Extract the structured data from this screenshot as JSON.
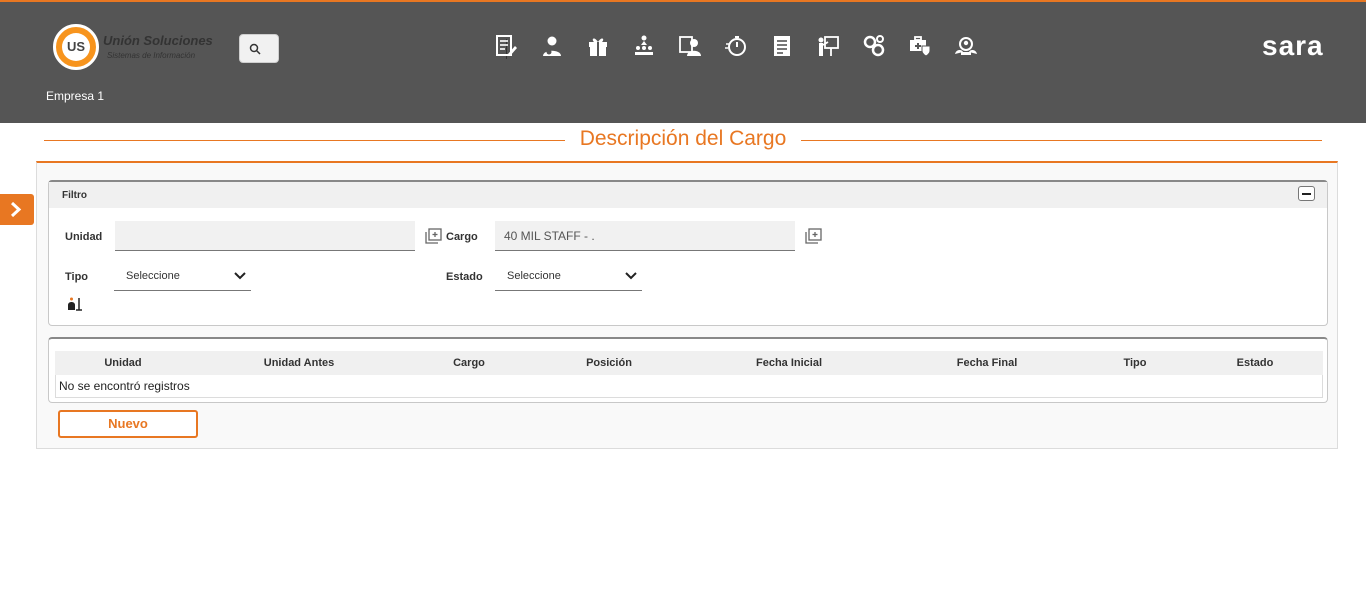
{
  "header": {
    "logo_mark": "US",
    "logo_name": "Unión Soluciones",
    "logo_tagline": "Sistemas de Información",
    "brand": "sara",
    "company": "Empresa 1",
    "accent_color": "#e87722",
    "nav_icons": [
      "document-edit-icon",
      "user-settings-icon",
      "gift-icon",
      "org-chart-icon",
      "user-id-icon",
      "stopwatch-icon",
      "report-icon",
      "training-icon",
      "gears-icon",
      "health-shield-icon",
      "group-search-icon"
    ]
  },
  "page": {
    "title": "Descripción del Cargo"
  },
  "filter": {
    "title": "Filtro",
    "unidad_label": "Unidad",
    "unidad_value": "",
    "cargo_label": "Cargo",
    "cargo_value": "40 MIL STAFF - .",
    "tipo_label": "Tipo",
    "tipo_value": "Seleccione",
    "estado_label": "Estado",
    "estado_value": "Seleccione"
  },
  "grid": {
    "columns": [
      "Unidad",
      "Unidad Antes",
      "Cargo",
      "Posición",
      "Fecha Inicial",
      "Fecha Final",
      "Tipo",
      "Estado"
    ],
    "empty_message": "No se encontró registros"
  },
  "actions": {
    "nuevo_label": "Nuevo"
  }
}
